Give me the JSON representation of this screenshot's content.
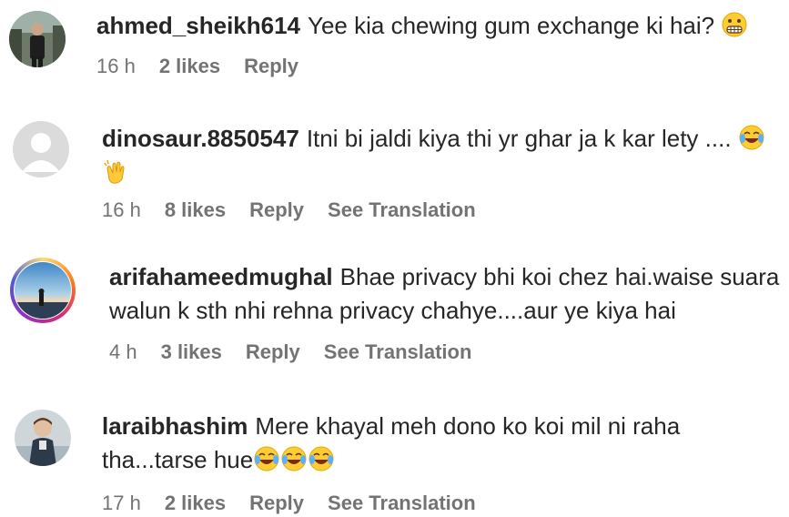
{
  "comments": [
    {
      "username": "ahmed_sheikh614",
      "text": "Yee kia chewing gum exchange ki hai?",
      "text_line2": "",
      "time": "16 h",
      "likes": "2 likes",
      "reply": "Reply",
      "translation": ""
    },
    {
      "username": "dinosaur.8850547",
      "text": "Itni bi jaldi kiya thi yr ghar ja k kar lety ....",
      "text_line2": "",
      "time": "16 h",
      "likes": "8 likes",
      "reply": "Reply",
      "translation": "See Translation"
    },
    {
      "username": "arifahameedmughal",
      "text": "Bhae privacy bhi koi chez hai.waise suara",
      "text_line2": "walun k sth nhi rehna privacy chahye....aur ye kiya hai",
      "time": "4 h",
      "likes": "3 likes",
      "reply": "Reply",
      "translation": "See Translation"
    },
    {
      "username": "laraibhashim",
      "text": "Mere khayal meh dono ko koi mil ni raha",
      "text_line2": "tha...tarse hue",
      "time": "17 h",
      "likes": "2 likes",
      "reply": "Reply",
      "translation": "See Translation"
    }
  ],
  "icons": {
    "grimace": "grimacing-face-icon",
    "laugh": "face-with-tears-of-joy-icon",
    "clap": "clapping-hands-icon"
  },
  "colors": {
    "text": "#262626",
    "meta": "#737373",
    "story_ring": "#d62976"
  }
}
